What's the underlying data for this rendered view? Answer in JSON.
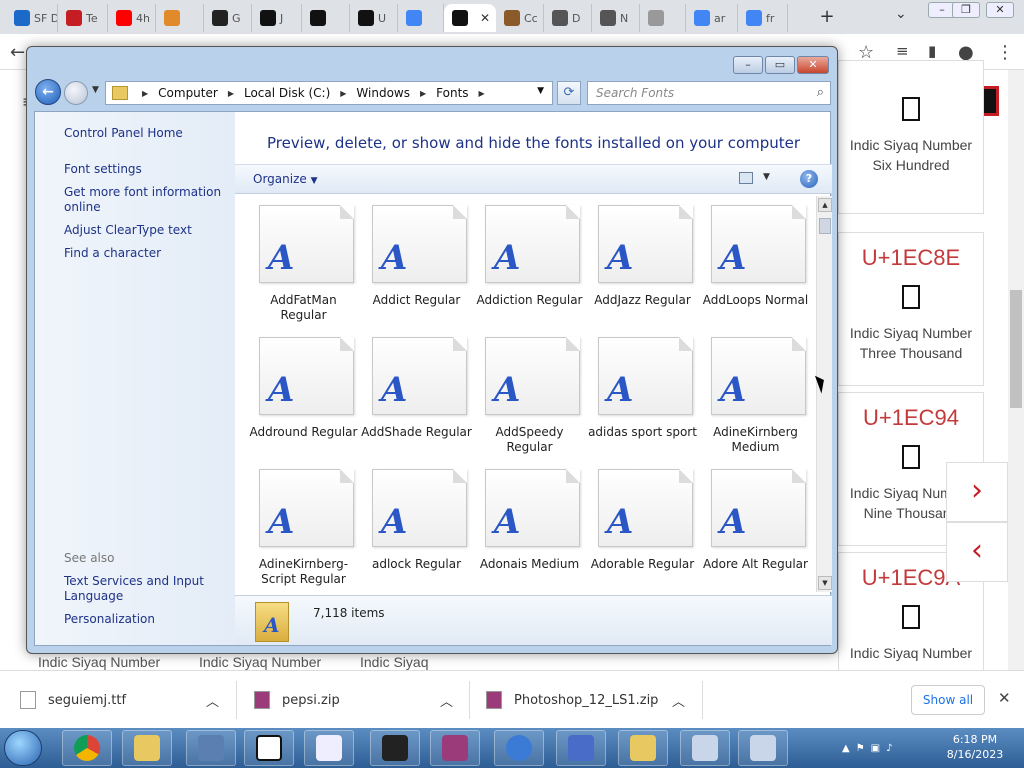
{
  "browser": {
    "tabs": [
      {
        "label": "SF D",
        "color": "#1b6ac9",
        "icon": "sf-icon"
      },
      {
        "label": "Te",
        "color": "#c41e24",
        "icon": "app-icon"
      },
      {
        "label": "4h",
        "color": "#ff0000",
        "icon": "youtube-icon"
      },
      {
        "label": "",
        "color": "#e08a2a",
        "icon": "shield-icon"
      },
      {
        "label": "G",
        "color": "#222222",
        "icon": "github-icon"
      },
      {
        "label": "J",
        "color": "#111111",
        "icon": "compart-icon"
      },
      {
        "label": "",
        "color": "#111111",
        "icon": "grid-icon"
      },
      {
        "label": "U",
        "color": "#111111",
        "icon": "unicode-icon"
      },
      {
        "label": "",
        "color": "#4285f4",
        "icon": "google-icon"
      },
      {
        "label": "",
        "color": "#111111",
        "icon": "compart-icon"
      },
      {
        "label": "Cc",
        "color": "#8a5a2b",
        "icon": "app-icon"
      },
      {
        "label": "D",
        "color": "#555555",
        "icon": "globe-icon"
      },
      {
        "label": "N",
        "color": "#555555",
        "icon": "chrome-icon"
      },
      {
        "label": "",
        "color": "#999999",
        "icon": "page-icon"
      },
      {
        "label": "ar",
        "color": "#4285f4",
        "icon": "google-icon"
      },
      {
        "label": "fr",
        "color": "#4285f4",
        "icon": "google-icon"
      }
    ],
    "new_tab": "+",
    "tab_search": "⌄"
  },
  "page": {
    "logo": "compart",
    "cards": [
      {
        "code": "",
        "name": "Indic Siyaq Number Six Hundred"
      },
      {
        "code": "U+1EC8E",
        "name": "Indic Siyaq Number Three Thousand"
      },
      {
        "code": "U+1EC94",
        "name": "Indic Siyaq Number Nine Thousand"
      },
      {
        "code": "U+1EC9A",
        "name": "Indic Siyaq Number"
      }
    ],
    "bottom_row": [
      "Indic Siyaq Number",
      "Indic Siyaq Number",
      "Indic Siyaq"
    ],
    "next_arrow": "›",
    "prev_arrow": "‹"
  },
  "explorer": {
    "breadcrumb": [
      "Computer",
      "Local Disk (C:)",
      "Windows",
      "Fonts"
    ],
    "search_placeholder": "Search Fonts",
    "left_links": [
      "Control Panel Home",
      "Font settings",
      "Get more font information online",
      "Adjust ClearType text",
      "Find a character"
    ],
    "see_also_label": "See also",
    "see_also_links": [
      "Text Services and Input Language",
      "Personalization"
    ],
    "heading": "Preview, delete, or show and hide the fonts installed on your computer",
    "organize": "Organize",
    "fonts": [
      "AddFatMan Regular",
      "Addict Regular",
      "Addiction Regular",
      "AddJazz Regular",
      "AddLoops Normal",
      "Addround Regular",
      "AddShade Regular",
      "AddSpeedy Regular",
      "adidas sport sport",
      "AdineKirnberg Medium",
      "AdineKirnberg-Script Regular",
      "adlock Regular",
      "Adonais Medium",
      "Adorable Regular",
      "Adore Alt Regular"
    ],
    "item_count": "7,118 items",
    "glyph": "A"
  },
  "downloads": {
    "items": [
      "seguiemj.ttf",
      "pepsi.zip",
      "Photoshop_12_LS1.zip"
    ],
    "show_all": "Show all"
  },
  "taskbar": {
    "time": "6:18 PM",
    "date": "8/16/2023"
  }
}
